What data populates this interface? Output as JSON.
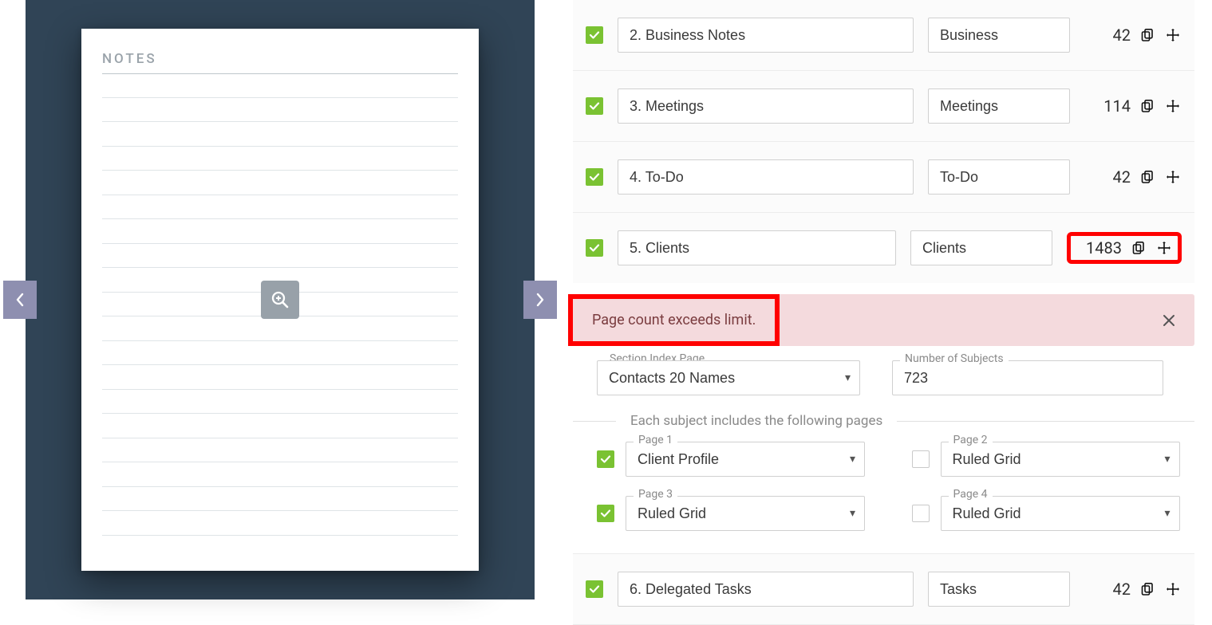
{
  "preview": {
    "page_title": "NOTES"
  },
  "sections": [
    {
      "name": "2. Business Notes",
      "label": "Business",
      "count": "42"
    },
    {
      "name": "3. Meetings",
      "label": "Meetings",
      "count": "114"
    },
    {
      "name": "4. To-Do",
      "label": "To-Do",
      "count": "42"
    },
    {
      "name": "5. Clients",
      "label": "Clients",
      "count": "1483"
    }
  ],
  "alert": {
    "message": "Page count exceeds limit."
  },
  "clients_detail": {
    "section_index_label": "Section Index Page",
    "section_index_value": "Contacts 20 Names",
    "subjects_label": "Number of Subjects",
    "subjects_value": "723",
    "pages_heading": "Each subject includes the following pages",
    "pages": [
      {
        "label": "Page 1",
        "value": "Client Profile",
        "checked": true
      },
      {
        "label": "Page 2",
        "value": "Ruled Grid",
        "checked": false
      },
      {
        "label": "Page 3",
        "value": "Ruled Grid",
        "checked": true
      },
      {
        "label": "Page 4",
        "value": "Ruled Grid",
        "checked": false
      }
    ]
  },
  "section_after": {
    "name": "6. Delegated Tasks",
    "label": "Tasks",
    "count": "42"
  }
}
